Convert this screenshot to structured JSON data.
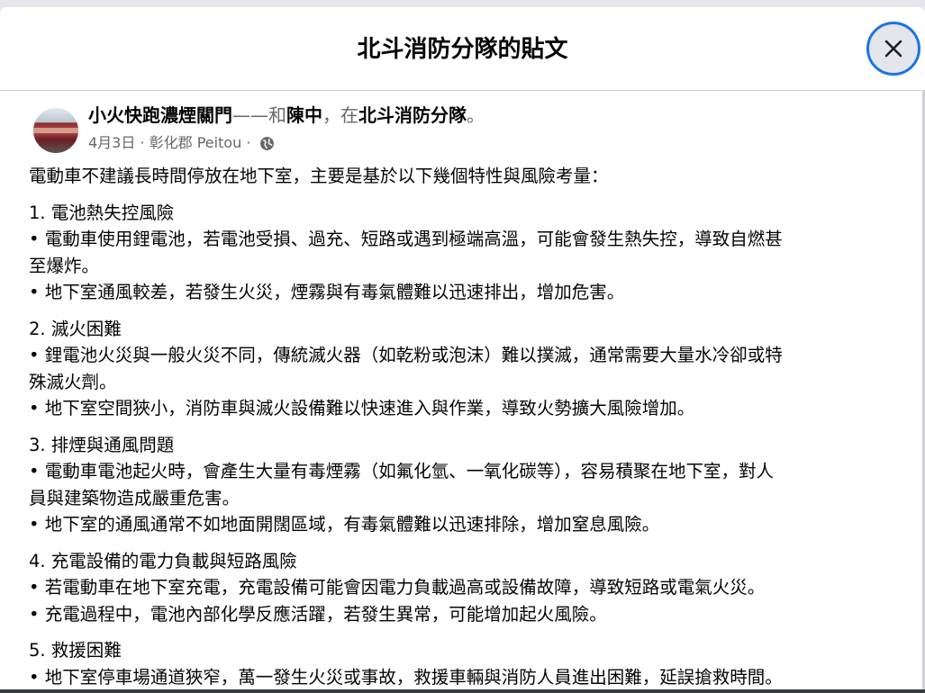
{
  "dialog": {
    "title": "北斗消防分隊的貼文",
    "close_icon": "close-icon"
  },
  "post": {
    "page_name": "小火快跑濃煙關門",
    "dash": "——",
    "with_word": "和",
    "tagged_person": "陳中",
    "comma_at": "，在",
    "location": "北斗消防分隊",
    "period": "。",
    "date": "4月3日",
    "place": " · 彰化郡 Peitou · ",
    "privacy_icon": "globe-icon",
    "intro": "電動車不建議長時間停放在地下室，主要是基於以下幾個特性與風險考量：",
    "sections": [
      {
        "heading": "1. 電池熱失控風險",
        "lines": [
          "• 電動車使用鋰電池，若電池受損、過充、短路或遇到極端高溫，可能會發生熱失控，導致自燃甚",
          "至爆炸。",
          "• 地下室通風較差，若發生火災，煙霧與有毒氣體難以迅速排出，增加危害。"
        ]
      },
      {
        "heading": "2. 滅火困難",
        "lines": [
          "• 鋰電池火災與一般火災不同，傳統滅火器（如乾粉或泡沫）難以撲滅，通常需要大量水冷卻或特",
          "殊滅火劑。",
          "• 地下室空間狹小，消防車與滅火設備難以快速進入與作業，導致火勢擴大風險增加。"
        ]
      },
      {
        "heading": "3. 排煙與通風問題",
        "lines": [
          "• 電動車電池起火時，會產生大量有毒煙霧（如氟化氫、一氧化碳等），容易積聚在地下室，對人",
          "員與建築物造成嚴重危害。",
          "• 地下室的通風通常不如地面開闊區域，有毒氣體難以迅速排除，增加窒息風險。"
        ]
      },
      {
        "heading": "4. 充電設備的電力負載與短路風險",
        "lines": [
          "• 若電動車在地下室充電，充電設備可能會因電力負載過高或設備故障，導致短路或電氣火災。",
          "• 充電過程中，電池內部化學反應活躍，若發生異常，可能增加起火風險。"
        ]
      },
      {
        "heading": "5. 救援困難",
        "lines": [
          "• 地下室停車場通道狹窄，萬一發生火災或事故，救援車輛與消防人員進出困難，延誤搶救時間。"
        ]
      }
    ]
  }
}
